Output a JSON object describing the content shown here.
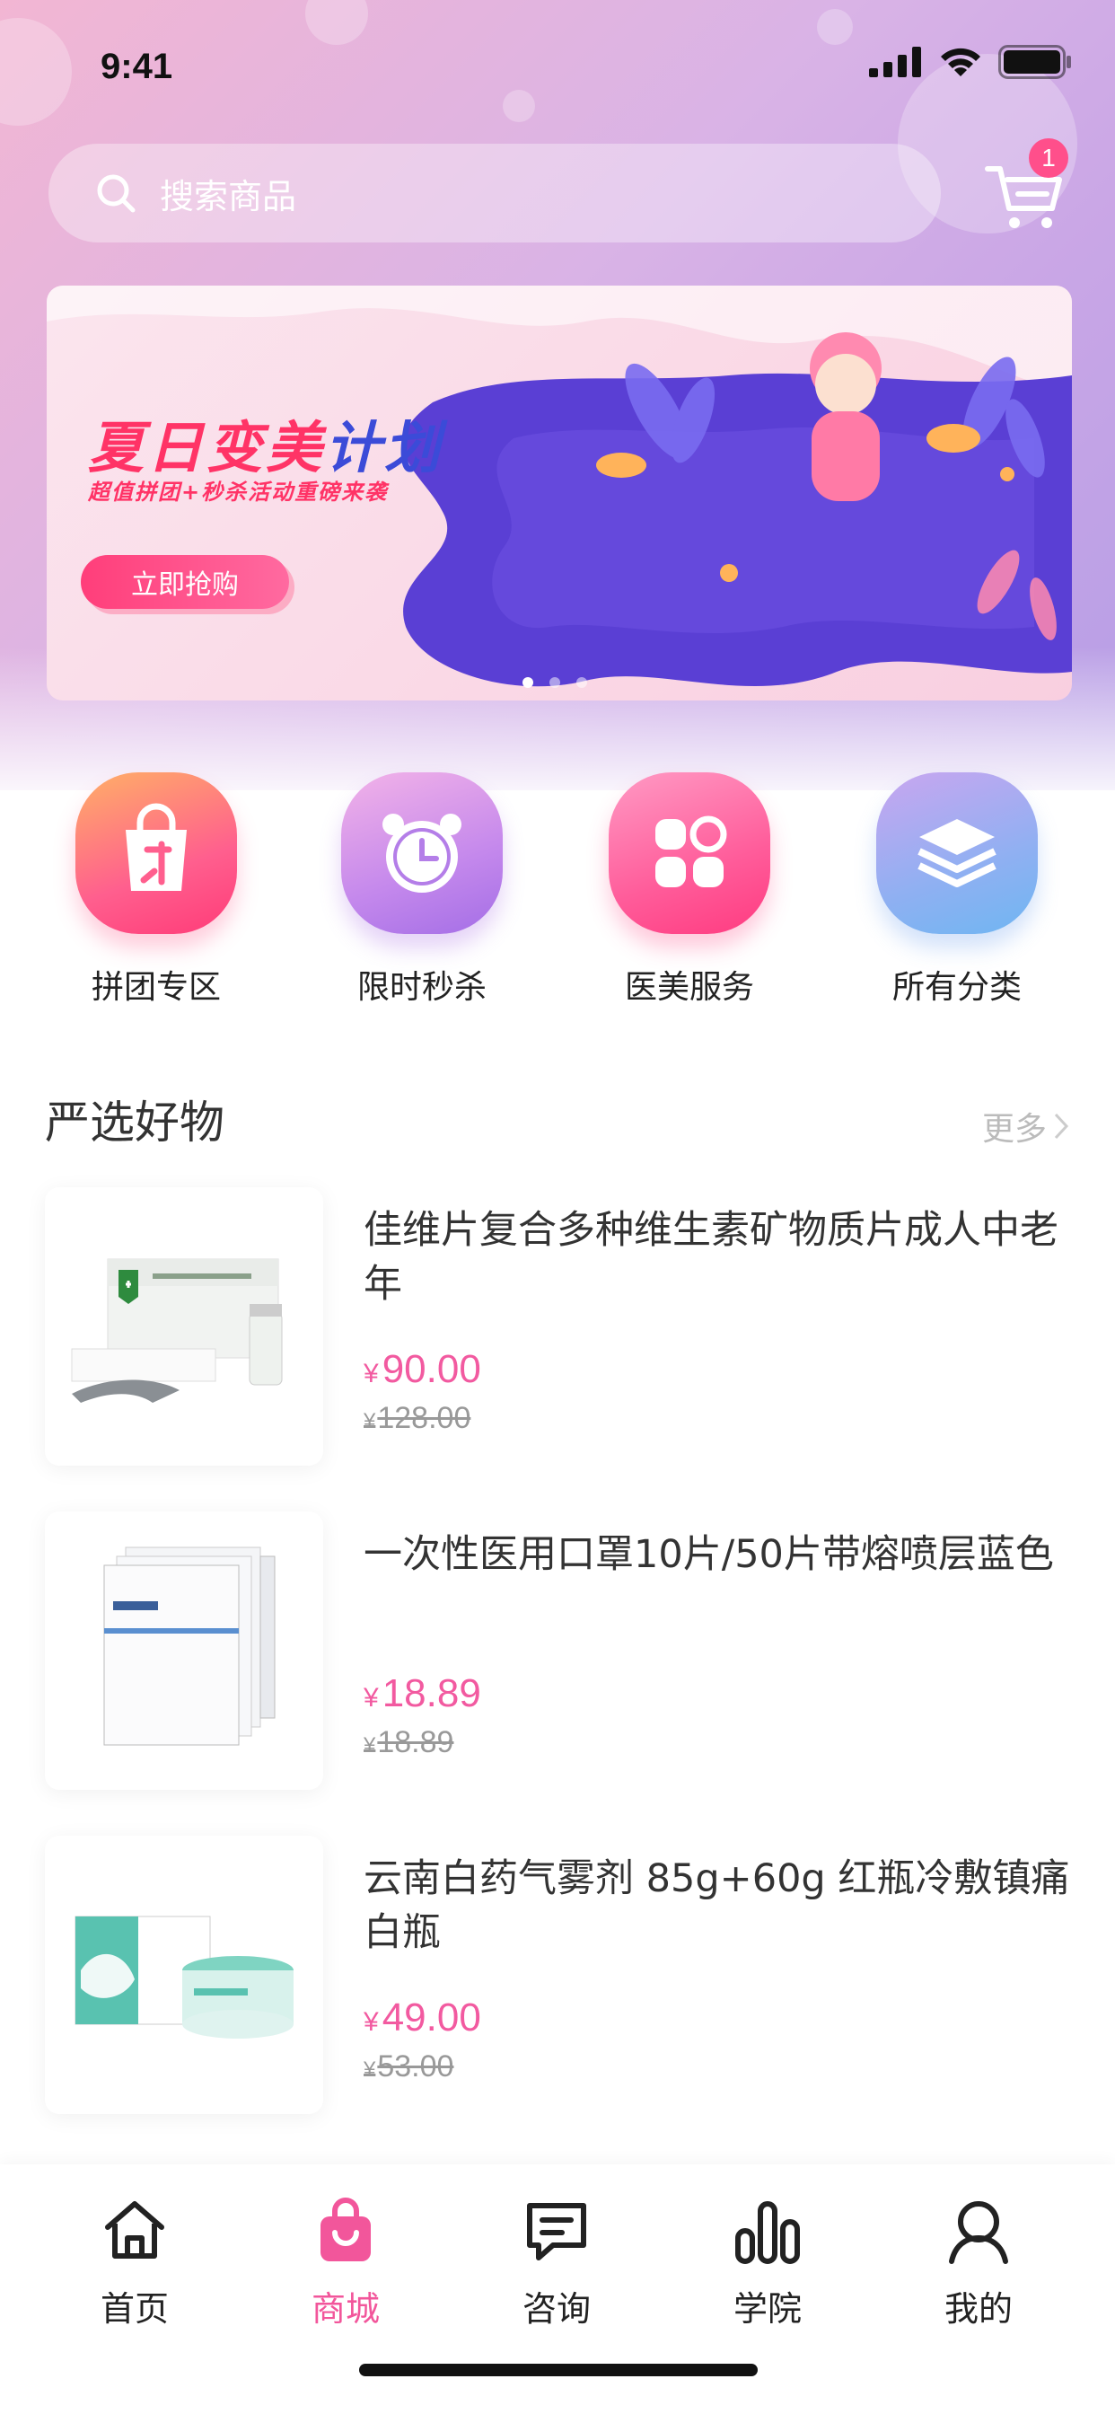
{
  "status_bar": {
    "time": "9:41"
  },
  "search": {
    "placeholder": "搜索商品"
  },
  "cart": {
    "badge_count": "1"
  },
  "banner": {
    "title_part1": "夏日变美",
    "title_part2": "计划",
    "subtitle": "超值拼团+秒杀活动重磅来袭",
    "button_label": "立即抢购",
    "slide_count": 3,
    "active_slide": 1
  },
  "categories": [
    {
      "label": "拼团专区",
      "icon": "shopping-bag-icon"
    },
    {
      "label": "限时秒杀",
      "icon": "alarm-clock-icon"
    },
    {
      "label": "医美服务",
      "icon": "clover-icon"
    },
    {
      "label": "所有分类",
      "icon": "layers-icon"
    }
  ],
  "section": {
    "title": "严选好物",
    "more_label": "更多"
  },
  "products": [
    {
      "title": "佳维片复合多种维生素矿物质片成人中老年",
      "currency": "¥",
      "price": "90.00",
      "original_price": "128.00"
    },
    {
      "title": "一次性医用口罩10片/50片带熔喷层蓝色",
      "currency": "¥",
      "price": "18.89",
      "original_price": "18.89"
    },
    {
      "title": "云南白药气雾剂 85g+60g 红瓶冷敷镇痛白瓶",
      "currency": "¥",
      "price": "49.00",
      "original_price": "53.00"
    }
  ],
  "tabs": [
    {
      "label": "首页",
      "icon": "home-icon",
      "active": false
    },
    {
      "label": "商城",
      "icon": "shop-bag-icon",
      "active": true
    },
    {
      "label": "咨询",
      "icon": "chat-icon",
      "active": false
    },
    {
      "label": "学院",
      "icon": "bar-chart-icon",
      "active": false
    },
    {
      "label": "我的",
      "icon": "user-icon",
      "active": false
    }
  ],
  "colors": {
    "accent": "#f2569b",
    "price": "#f25aa0",
    "badge": "#ff4f8b"
  }
}
